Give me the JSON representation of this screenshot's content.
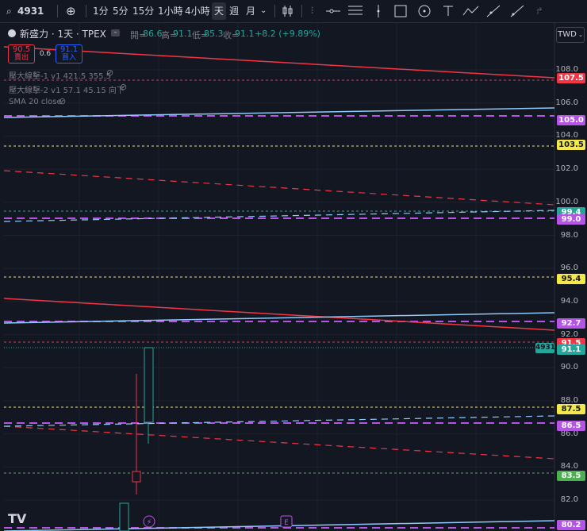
{
  "toolbar": {
    "symbol": "4931",
    "intervals": [
      "1分",
      "5分",
      "15分",
      "1小時",
      "4小時",
      "天",
      "週",
      "月"
    ],
    "active_interval": "天"
  },
  "header": {
    "title": "新盛力 · 1天 · TPEX",
    "open_label": "開=",
    "open": "86.6",
    "high_label": "高=",
    "high": "91.1",
    "low_label": "低=",
    "low": "85.3",
    "close_label": "收=",
    "close": "91.1",
    "change": "+8.2 (+9.89%)",
    "sell_price": "90.5",
    "sell_label": "賣出",
    "spread": "0.6",
    "buy_price": "91.1",
    "buy_label": "買入"
  },
  "indicators": [
    "壓大線擊-1 v1 421.5 355.5",
    "壓大線擊-2 v1 57.1 45.15 向下",
    "SMA 20 close"
  ],
  "currency": "TWD",
  "axis": {
    "ticks": [
      "108.0",
      "106.0",
      "104.0",
      "102.0",
      "100.0",
      "98.0",
      "96.0",
      "94.0",
      "92.0",
      "90.0",
      "88.0",
      "86.0",
      "84.0",
      "82.0"
    ]
  },
  "price_tags": [
    {
      "value": "107.5",
      "color": "#f23645"
    },
    {
      "value": "105.0",
      "color": "#b654e6"
    },
    {
      "value": "103.5",
      "color": "#f5e84b"
    },
    {
      "value": "99.4",
      "color": "#26a69a"
    },
    {
      "value": "99.0",
      "color": "#b654e6"
    },
    {
      "value": "95.4",
      "color": "#f5e84b"
    },
    {
      "value": "92.7",
      "color": "#b654e6"
    },
    {
      "value": "91.5",
      "color": "#f23645"
    },
    {
      "value": "91.1",
      "color": "#26a69a"
    },
    {
      "value": "87.5",
      "color": "#f5e84b"
    },
    {
      "value": "86.5",
      "color": "#b654e6"
    },
    {
      "value": "83.5",
      "color": "#4caf50"
    },
    {
      "value": "80.2",
      "color": "#b654e6"
    }
  ],
  "symbol_tag": "4931",
  "logo": "TV"
}
